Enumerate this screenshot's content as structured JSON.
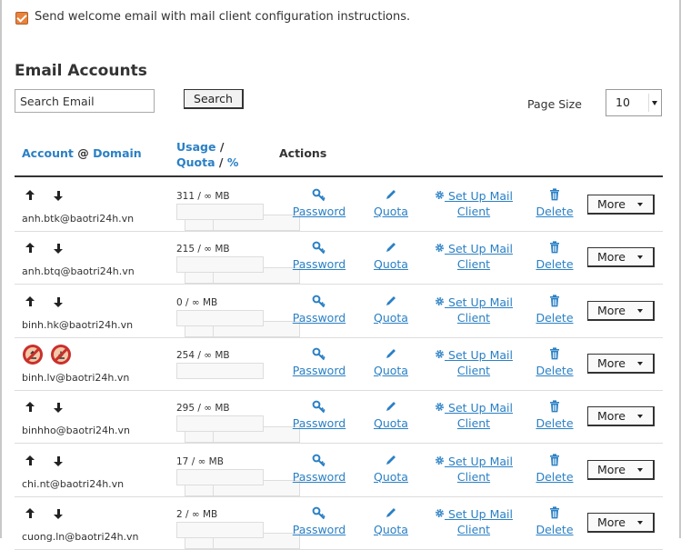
{
  "welcome": {
    "label": "Send welcome email with mail client configuration instructions.",
    "checked": true
  },
  "title": "Email Accounts",
  "search": {
    "placeholder": "Search Email",
    "button": "Search"
  },
  "page_size": {
    "label": "Page Size",
    "value": "10"
  },
  "headers": {
    "account": "Account",
    "at": "@",
    "domain": "Domain",
    "usage": "Usage",
    "slash1": "/",
    "quota": "Quota",
    "slash2": "/",
    "percent": "%",
    "actions": "Actions"
  },
  "actions": {
    "password": "Password",
    "quota": "Quota",
    "setup_line1": "Set Up Mail",
    "setup_line2": "Client",
    "delete": "Delete",
    "more": "More"
  },
  "accounts": [
    {
      "email": "anh.btk@baotri24h.vn",
      "usage": "311 / ∞ MB",
      "suspended": false
    },
    {
      "email": "anh.btq@baotri24h.vn",
      "usage": "215 / ∞ MB",
      "suspended": false
    },
    {
      "email": "binh.hk@baotri24h.vn",
      "usage": "0 / ∞ MB",
      "suspended": false
    },
    {
      "email": "binh.lv@baotri24h.vn",
      "usage": "254 / ∞ MB",
      "suspended": true
    },
    {
      "email": "binhho@baotri24h.vn",
      "usage": "295 / ∞ MB",
      "suspended": false
    },
    {
      "email": "chi.nt@baotri24h.vn",
      "usage": "17 / ∞ MB",
      "suspended": false
    },
    {
      "email": "cuong.ln@baotri24h.vn",
      "usage": "2 / ∞ MB",
      "suspended": false
    }
  ]
}
